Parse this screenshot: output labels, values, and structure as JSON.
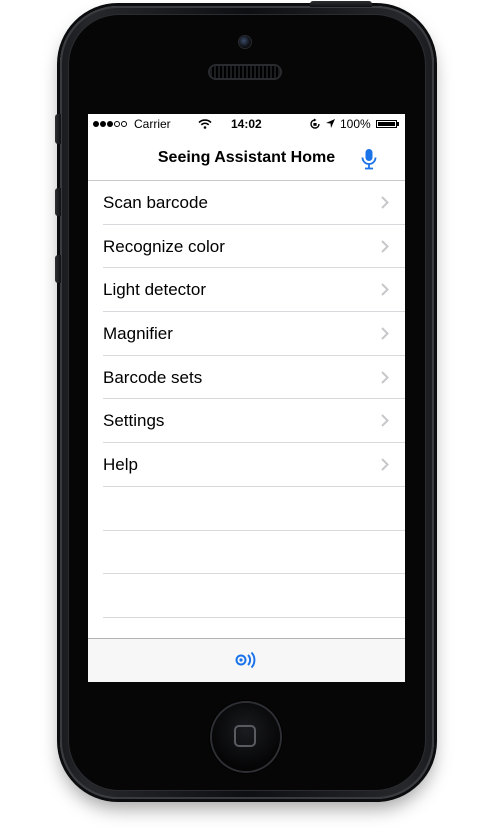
{
  "status_bar": {
    "carrier": "Carrier",
    "time": "14:02",
    "battery": "100%",
    "signal_bars_filled": 3,
    "signal_bars_total": 5,
    "battery_level": 1.0
  },
  "nav": {
    "title": "Seeing Assistant Home",
    "mic_icon": "microphone-icon"
  },
  "menu": {
    "items": [
      {
        "label": "Scan barcode"
      },
      {
        "label": "Recognize color"
      },
      {
        "label": "Light detector"
      },
      {
        "label": "Magnifier"
      },
      {
        "label": "Barcode sets"
      },
      {
        "label": "Settings"
      },
      {
        "label": "Help"
      }
    ],
    "empty_rows": 3
  },
  "toolbar": {
    "icon": "voice-over-icon"
  },
  "colors": {
    "accent": "#1a73e8",
    "separator": "#d9d9dd",
    "chevron": "#c7c7cc",
    "phone_body": "#0e0f12"
  }
}
